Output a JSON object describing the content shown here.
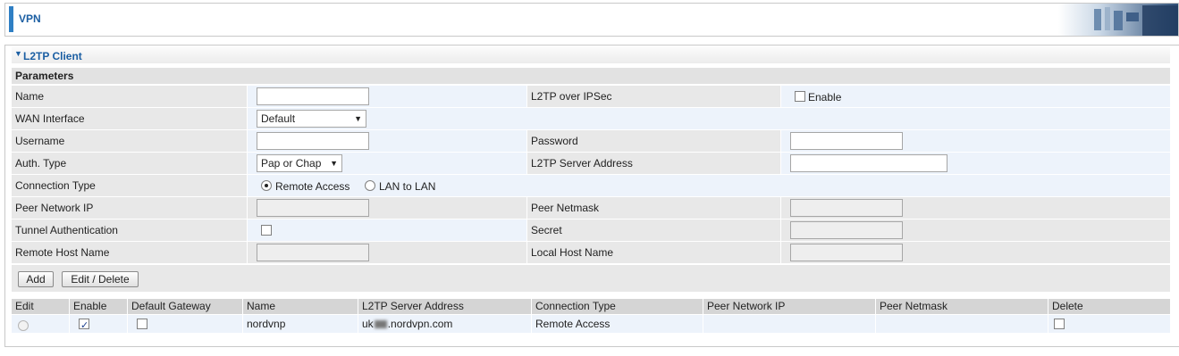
{
  "header": {
    "title": "VPN",
    "banner_icon": "office-banner-image"
  },
  "section": {
    "title": "L2TP Client",
    "params_title": "Parameters"
  },
  "form": {
    "name_label": "Name",
    "name_value": "",
    "l2tp_ipsec_label": "L2TP over IPSec",
    "l2tp_ipsec_enable_label": "Enable",
    "l2tp_ipsec_checked": false,
    "wan_label": "WAN Interface",
    "wan_value": "Default",
    "username_label": "Username",
    "username_value": "",
    "password_label": "Password",
    "password_value": "",
    "auth_label": "Auth. Type",
    "auth_value": "Pap or Chap",
    "server_label": "L2TP Server Address",
    "server_value": "",
    "conn_label": "Connection Type",
    "conn_remote_label": "Remote Access",
    "conn_lan_label": "LAN to LAN",
    "conn_selected": "Remote Access",
    "peer_ip_label": "Peer Network IP",
    "peer_mask_label": "Peer Netmask",
    "tunnel_auth_label": "Tunnel Authentication",
    "tunnel_auth_checked": false,
    "secret_label": "Secret",
    "remote_host_label": "Remote Host Name",
    "local_host_label": "Local Host Name"
  },
  "buttons": {
    "add": "Add",
    "edit_delete": "Edit / Delete"
  },
  "table": {
    "columns": [
      "Edit",
      "Enable",
      "Default Gateway",
      "Name",
      "L2TP Server Address",
      "Connection Type",
      "Peer Network IP",
      "Peer Netmask",
      "Delete"
    ],
    "rows": [
      {
        "enable": true,
        "default_gateway": false,
        "name": "nordvnp",
        "server_prefix": "uk",
        "server_suffix": ".nordvpn.com",
        "connection_type": "Remote Access",
        "peer_ip": "",
        "peer_mask": "",
        "delete": false
      }
    ]
  }
}
